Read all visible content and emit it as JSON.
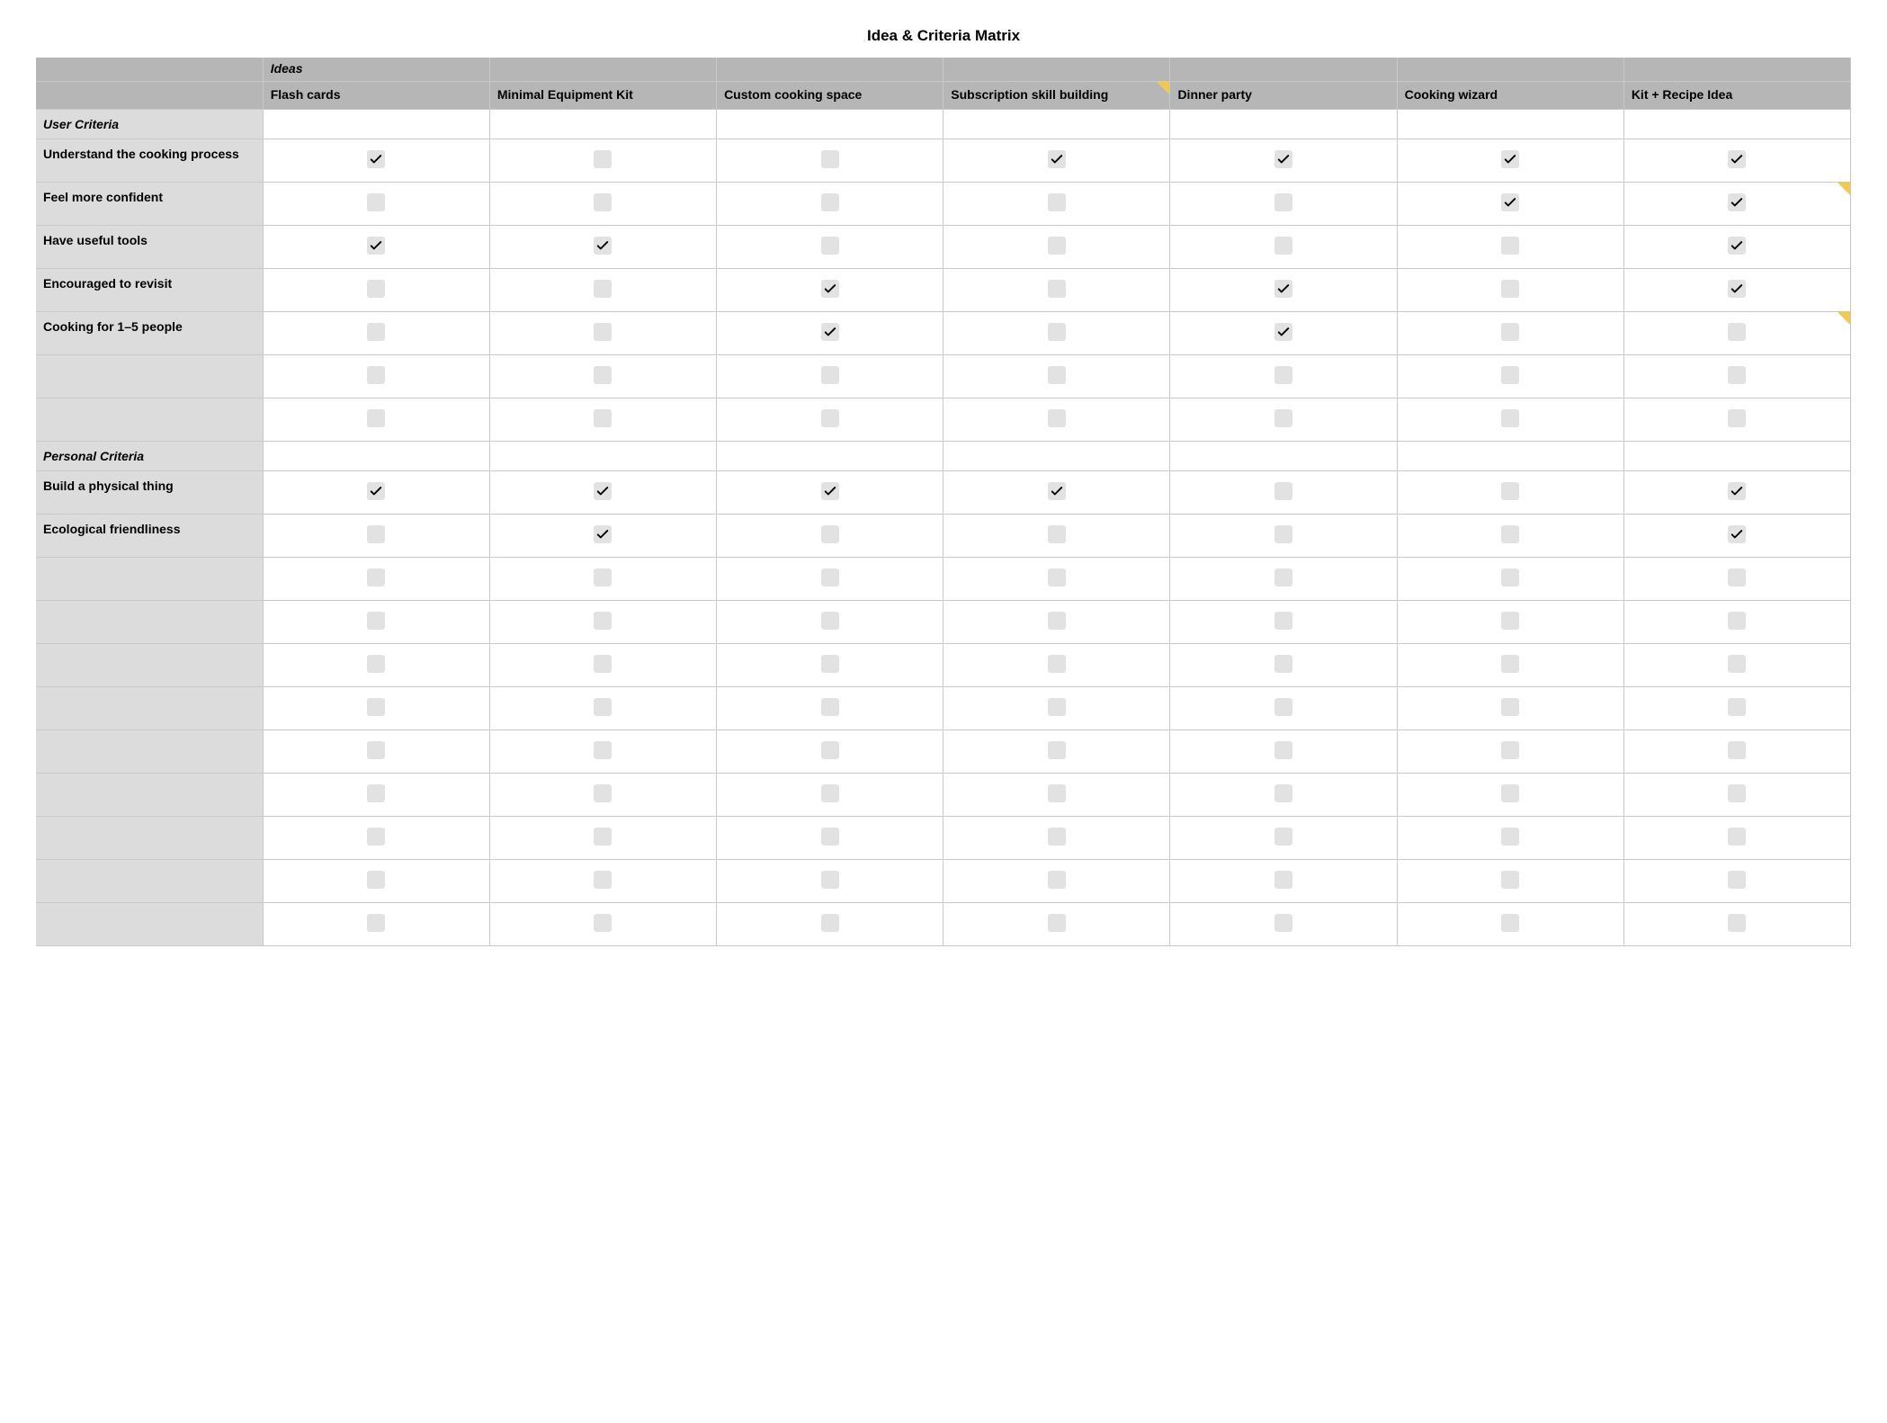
{
  "title": "Idea & Criteria Matrix",
  "ideas_header": "Ideas",
  "ideas": [
    "Flash cards",
    "Minimal Equipment Kit",
    "Custom cooking space",
    "Subscription skill building",
    "Dinner party",
    "Cooking wizard",
    "Kit + Recipe Idea"
  ],
  "idea_flags": [
    false,
    false,
    false,
    true,
    false,
    false,
    false
  ],
  "sections": [
    {
      "label": "User Criteria",
      "rows": [
        {
          "label": "Understand the cooking process",
          "checks": [
            true,
            false,
            false,
            true,
            true,
            true,
            true
          ],
          "flags": [
            false,
            false,
            false,
            false,
            false,
            false,
            false
          ]
        },
        {
          "label": "Feel more confident",
          "checks": [
            false,
            false,
            false,
            false,
            false,
            true,
            true
          ],
          "flags": [
            false,
            false,
            false,
            false,
            false,
            false,
            true
          ]
        },
        {
          "label": "Have useful tools",
          "checks": [
            true,
            true,
            false,
            false,
            false,
            false,
            true
          ],
          "flags": [
            false,
            false,
            false,
            false,
            false,
            false,
            false
          ]
        },
        {
          "label": "Encouraged to revisit",
          "checks": [
            false,
            false,
            true,
            false,
            true,
            false,
            true
          ],
          "flags": [
            false,
            false,
            false,
            false,
            false,
            false,
            false
          ]
        },
        {
          "label": "Cooking for 1–5 people",
          "checks": [
            false,
            false,
            true,
            false,
            true,
            false,
            false
          ],
          "flags": [
            false,
            false,
            false,
            false,
            false,
            false,
            true
          ]
        },
        {
          "label": "",
          "checks": [
            false,
            false,
            false,
            false,
            false,
            false,
            false
          ],
          "flags": [
            false,
            false,
            false,
            false,
            false,
            false,
            false
          ]
        },
        {
          "label": "",
          "checks": [
            false,
            false,
            false,
            false,
            false,
            false,
            false
          ],
          "flags": [
            false,
            false,
            false,
            false,
            false,
            false,
            false
          ]
        }
      ]
    },
    {
      "label": "Personal Criteria",
      "rows": [
        {
          "label": "Build a physical thing",
          "checks": [
            true,
            true,
            true,
            true,
            false,
            false,
            true
          ],
          "flags": [
            false,
            false,
            false,
            false,
            false,
            false,
            false
          ]
        },
        {
          "label": "Ecological friendliness",
          "checks": [
            false,
            true,
            false,
            false,
            false,
            false,
            true
          ],
          "flags": [
            false,
            false,
            false,
            false,
            false,
            false,
            false
          ]
        },
        {
          "label": "",
          "checks": [
            false,
            false,
            false,
            false,
            false,
            false,
            false
          ],
          "flags": [
            false,
            false,
            false,
            false,
            false,
            false,
            false
          ]
        },
        {
          "label": "",
          "checks": [
            false,
            false,
            false,
            false,
            false,
            false,
            false
          ],
          "flags": [
            false,
            false,
            false,
            false,
            false,
            false,
            false
          ]
        },
        {
          "label": "",
          "checks": [
            false,
            false,
            false,
            false,
            false,
            false,
            false
          ],
          "flags": [
            false,
            false,
            false,
            false,
            false,
            false,
            false
          ]
        },
        {
          "label": "",
          "checks": [
            false,
            false,
            false,
            false,
            false,
            false,
            false
          ],
          "flags": [
            false,
            false,
            false,
            false,
            false,
            false,
            false
          ]
        },
        {
          "label": "",
          "checks": [
            false,
            false,
            false,
            false,
            false,
            false,
            false
          ],
          "flags": [
            false,
            false,
            false,
            false,
            false,
            false,
            false
          ]
        },
        {
          "label": "",
          "checks": [
            false,
            false,
            false,
            false,
            false,
            false,
            false
          ],
          "flags": [
            false,
            false,
            false,
            false,
            false,
            false,
            false
          ]
        },
        {
          "label": "",
          "checks": [
            false,
            false,
            false,
            false,
            false,
            false,
            false
          ],
          "flags": [
            false,
            false,
            false,
            false,
            false,
            false,
            false
          ]
        },
        {
          "label": "",
          "checks": [
            false,
            false,
            false,
            false,
            false,
            false,
            false
          ],
          "flags": [
            false,
            false,
            false,
            false,
            false,
            false,
            false
          ]
        },
        {
          "label": "",
          "checks": [
            false,
            false,
            false,
            false,
            false,
            false,
            false
          ],
          "flags": [
            false,
            false,
            false,
            false,
            false,
            false,
            false
          ]
        }
      ]
    }
  ]
}
